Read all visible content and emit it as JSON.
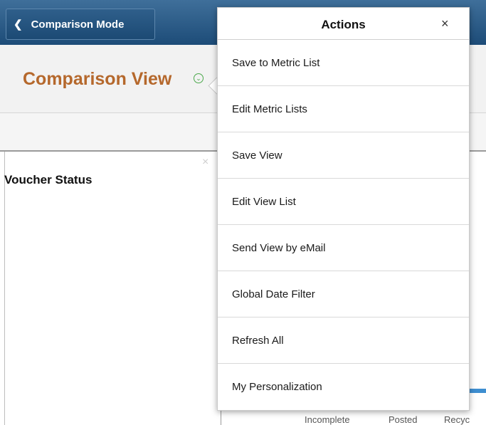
{
  "header": {
    "back_label": "Comparison Mode"
  },
  "page": {
    "title": "Comparison View",
    "section_label": "Voucher Status"
  },
  "chart_legend": [
    "Incomplete",
    "Posted",
    "Recyc"
  ],
  "actions_popup": {
    "title": "Actions",
    "close_glyph": "×",
    "items": [
      {
        "label": "Save to Metric List"
      },
      {
        "label": "Edit Metric Lists"
      },
      {
        "label": "Save View"
      },
      {
        "label": "Edit View List"
      },
      {
        "label": "Send View by eMail"
      },
      {
        "label": "Global Date Filter"
      },
      {
        "label": "Refresh All"
      },
      {
        "label": "My Personalization"
      }
    ]
  },
  "icons": {
    "back": "chevron-left-icon",
    "title_menu": "chevron-down-circle-icon",
    "close": "close-icon"
  },
  "colors": {
    "header": "#1d4c78",
    "title": "#b5682c",
    "accent_green": "#4aa84a"
  }
}
